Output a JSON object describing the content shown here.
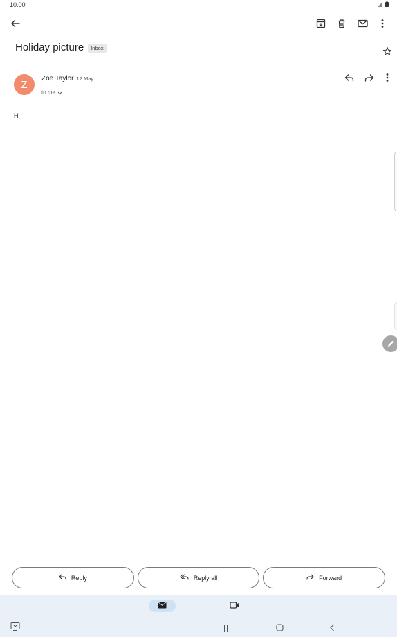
{
  "status_bar": {
    "time": "10.00",
    "icons": [
      "signal-icon",
      "battery-icon"
    ]
  },
  "top_bar": {
    "icons": [
      "back-arrow-icon",
      "archive-icon",
      "delete-icon",
      "mark-unread-icon",
      "more-vert-icon"
    ]
  },
  "email": {
    "subject": "Holiday picture",
    "label": "Inbox",
    "sender": {
      "initial": "Z",
      "name": "Zoe Taylor",
      "date": "12 May",
      "recipient": "to me"
    },
    "body": "Hi"
  },
  "actions": {
    "reply": "Reply",
    "reply_all": "Reply all",
    "forward": "Forward"
  },
  "bottom_nav": {
    "items": [
      "mail-icon",
      "video-camera-icon"
    ]
  },
  "colors": {
    "avatar": "#f28b6d",
    "nav_background": "#e9f0f7",
    "nav_active_pill": "#cfe2f3"
  }
}
